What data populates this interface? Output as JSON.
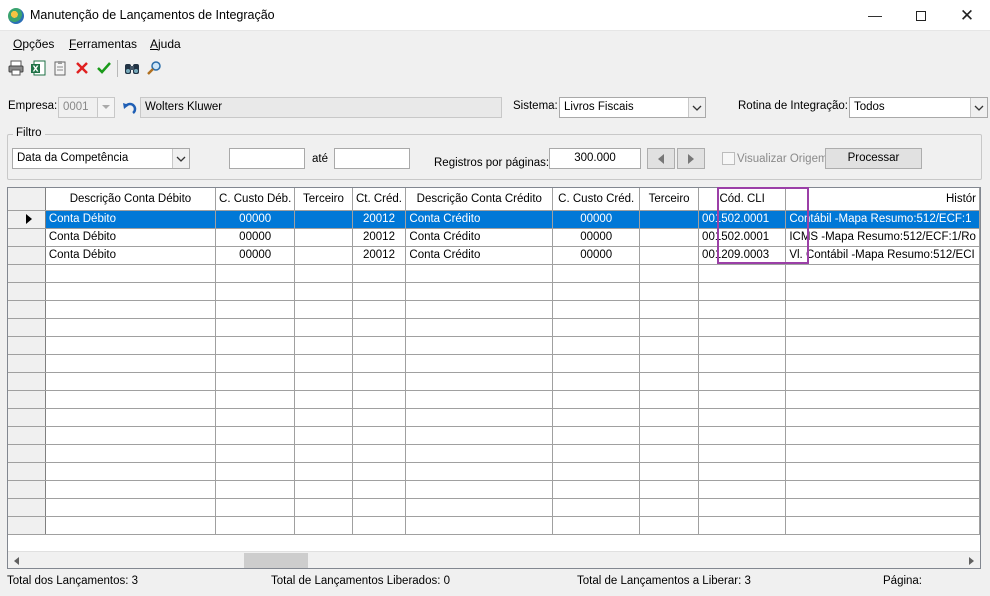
{
  "window": {
    "title": "Manutenção de Lançamentos de Integração"
  },
  "menu": [
    {
      "label": "Opções",
      "underline": "O",
      "rest": "pções"
    },
    {
      "label": "Ferramentas",
      "underline": "F",
      "rest": "erramentas"
    },
    {
      "label": "Ajuda",
      "underline": "A",
      "rest": "juda"
    }
  ],
  "toolbar": {
    "icons": [
      "printer-icon",
      "excel-export-icon",
      "clipboard-icon",
      "delete-icon",
      "confirm-icon",
      "binoculars-icon",
      "magnifier-icon"
    ]
  },
  "empresa": {
    "label": "Empresa:",
    "code": "0001",
    "name": "Wolters Kluwer"
  },
  "sistema": {
    "label": "Sistema:",
    "value": "Livros Fiscais"
  },
  "rotina": {
    "label": "Rotina de Integração:",
    "value": "Todos"
  },
  "filtro": {
    "label": "Filtro",
    "campo": "Data da Competência",
    "de": "",
    "ate_label": "até",
    "ate": "",
    "registros_label": "Registros por páginas:",
    "registros": "300.000",
    "visualizar_origem": "Visualizar Origem",
    "processar": "Processar"
  },
  "grid": {
    "columns": [
      "Descrição Conta Débito",
      "C. Custo Déb.",
      "Terceiro",
      "Ct. Créd.",
      "Descrição Conta Crédito",
      "C. Custo Créd.",
      "Terceiro",
      "Cód. CLI",
      "Histór"
    ],
    "rows": [
      {
        "desc_debito": "Conta Débito",
        "custo_deb": "00000",
        "terceiro1": "",
        "ct_cred": "20012",
        "desc_credito": "Conta Crédito",
        "custo_cred": "00000",
        "terceiro2": "",
        "cod_cli": "001502.0001",
        "historico": "Contábil -Mapa Resumo:512/ECF:1"
      },
      {
        "desc_debito": "Conta Débito",
        "custo_deb": "00000",
        "terceiro1": "",
        "ct_cred": "20012",
        "desc_credito": "Conta Crédito",
        "custo_cred": "00000",
        "terceiro2": "",
        "cod_cli": "001502.0001",
        "historico": "ICMS -Mapa Resumo:512/ECF:1/Ro"
      },
      {
        "desc_debito": "Conta Débito",
        "custo_deb": "00000",
        "terceiro1": "",
        "ct_cred": "20012",
        "desc_credito": "Conta Crédito",
        "custo_cred": "00000",
        "terceiro2": "",
        "cod_cli": "001209.0003",
        "historico": "Vl. Contábil -Mapa Resumo:512/ECI"
      }
    ],
    "selected_row": 0,
    "highlight_color": "#9b3fa7",
    "selection_color": "#0078d7"
  },
  "status": {
    "total": "Total dos Lançamentos: 3",
    "liberados": "Total de Lançamentos Liberados: 0",
    "a_liberar": "Total de Lançamentos a Liberar: 3",
    "pagina": "Página:"
  }
}
